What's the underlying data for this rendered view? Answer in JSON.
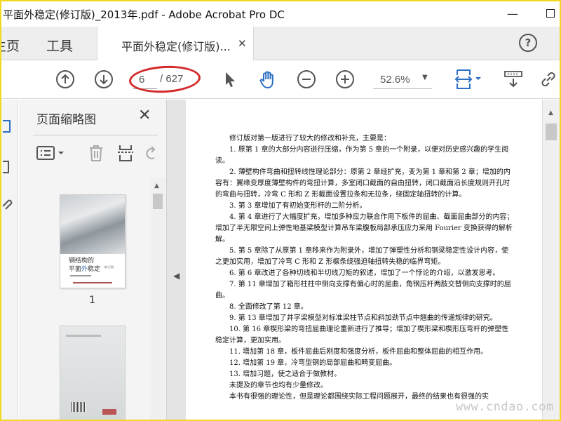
{
  "window": {
    "title": "平面外稳定(修订版)_2013年.pdf - Adobe Acrobat Pro DC",
    "minimize_icon": "—"
  },
  "tabs": {
    "home_label": "主页",
    "tools_label": "工具",
    "document_tab_label": "平面外稳定(修订版)...",
    "close_icon": "✕",
    "help_icon": "?"
  },
  "toolbar": {
    "page_current": "6",
    "page_total": "/ 627",
    "zoom_value": "52.6%",
    "zoom_arrow": "▼",
    "annotation_color": "#d42a2a"
  },
  "sidebar_panel": {
    "title": "页面缩略图",
    "close_icon": "✕",
    "thumbnails": [
      {
        "page_label": "1",
        "cover_title_line1": "钢结构的",
        "cover_title_line2_pre": "平面",
        "cover_title_line2_hl": "外",
        "cover_title_line2_post": "稳定",
        "cover_subtitle": "(修订版)"
      },
      {
        "page_label": ""
      }
    ]
  },
  "document": {
    "paragraphs": [
      "修订版对第一版进行了较大的修改和补充，主要是：",
      "1. 原第 1 章的大部分内容进行压缩，作为第 5 章的一个附录，以便对历史感兴趣的学生阅读。",
      "2. 薄壁构件弯曲和扭转线性理论部分：原第 2 章经扩充，变为第 1 章和第 2 章；增加的内容有：翼缘变厚度薄壁构件的弯扭计算，多室闭口截面的自由扭转，闭口截面沿长度规则开孔时的弯曲与扭转，冷弯 C 形和 Z 形截面设置拉条和无拉条，绕固定轴扭转的计算。",
      "3. 第 3 章增加了有初始变形杆的二阶分析。",
      "4. 第 4 章进行了大幅度扩充，增加多种应力联合作用下板件的屈曲、截面屈曲部分的内容；增加了半无限空间上弹性地基梁模型计算吊车梁腹板局部承压应力采用 Fourier 变换获得的解析解。",
      "5. 第 5 章除了从原第 1 章移来作为附录外，增加了弹塑性分析和钢梁稳定性设计内容，使之更加实用，增加了冷弯 C 形和 Z 形檩条绕强迫轴扭转失稳的临界弯矩。",
      "6. 第 6 章改进了各种切线和半切线刀矩的叙述，增加了一个悖论的介绍，以激发思考。",
      "7. 第 11 章增加了箱形柱柱中侧向支撑有偏心时的屈曲，角钢压杆两肢交替侧向支撑时的屈曲。",
      "8. 全面修改了第 12 章。",
      "9. 第 13 章增加了井字梁模型对标准梁柱节点和斜加劲节点中翘曲的传递规律的研究。",
      "10. 第 16 章楔形梁的弯扭屈曲理论重新进行了推导；增加了楔形梁和楔形压弯杆的弹塑性稳定计算，更加实用。",
      "11. 增加第 18 章，板件屈曲后刚度和强度分析，板件屈曲和整体屈曲的相互作用。",
      "12. 增加第 19 章，冷弯型钢的局部屈曲和畸变屈曲。",
      "13. 增加习题，使之适合于做教材。",
      "未提及的章节也均有少量修改。",
      "本书有很强的理论性，但是理论都围绕实际工程问题展开，最终的结果也有很强的实"
    ]
  },
  "watermark": "www.cndao.com"
}
